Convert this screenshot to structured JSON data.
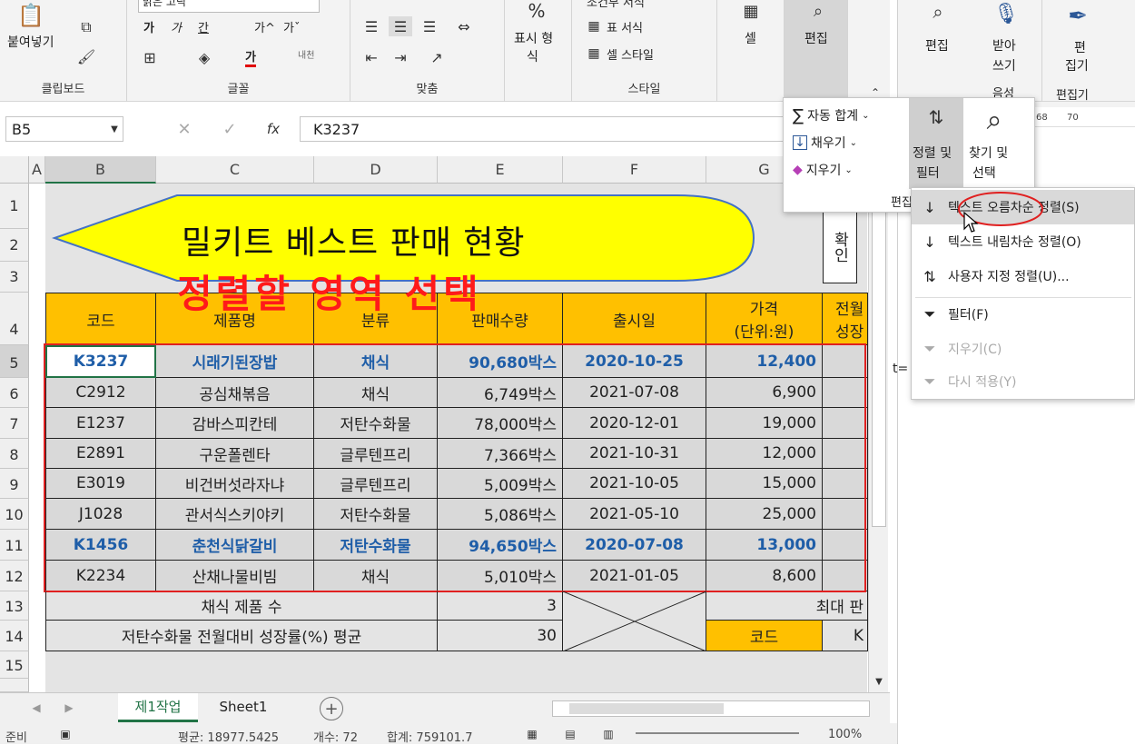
{
  "ribbon": {
    "clipboard": {
      "paste_label": "붙여넣기",
      "group_label": "클립보드"
    },
    "font": {
      "font_name": "맑은 고딕",
      "group_label": "글꼴",
      "bold": "가",
      "italic": "가",
      "underline": "간",
      "grow": "가^",
      "shrink": "가ˇ",
      "font_color": "가",
      "phonetic": "내천"
    },
    "align": {
      "group_label": "맞춤"
    },
    "number": {
      "percent": "%",
      "label1": "표시 형",
      "label2": "식"
    },
    "styles": {
      "cond_format": "조건부 서식",
      "table_format": "표 서식",
      "cell_style": "셀 스타일",
      "group_label": "스타일"
    },
    "cells": {
      "label": "셀"
    },
    "editing": {
      "label": "편집"
    }
  },
  "right_ribbon": {
    "edit_label": "편집",
    "dictation_label1": "받아",
    "dictation_label2": "쓰기",
    "voice_group": "음성",
    "editor_label1": "편",
    "editor_label2": "집기",
    "editor_group": "편집기",
    "zoom_ticks": [
      "68",
      "70"
    ],
    "equals_fragment": "t="
  },
  "formula_bar": {
    "name_box": "B5",
    "formula": "K3237",
    "fx": "fx"
  },
  "columns": [
    "A",
    "B",
    "C",
    "D",
    "E",
    "F",
    "G"
  ],
  "rows": [
    "1",
    "2",
    "3",
    "4",
    "5",
    "6",
    "7",
    "8",
    "9",
    "10",
    "11",
    "12",
    "13",
    "14",
    "15"
  ],
  "banner": {
    "title": "밀키트 베스트 판매 현황",
    "overlay_text": "정렬할 영역 선택",
    "confirm": "확인"
  },
  "table": {
    "headers": [
      "코드",
      "제품명",
      "분류",
      "판매수량",
      "출시일",
      "가격\n(단위:원)",
      "전월\n성장"
    ],
    "price_header_line1": "가격",
    "price_header_line2": "(단위:원)",
    "growth_header_line1": "전월",
    "growth_header_line2": "성장",
    "rows": [
      {
        "code": "K3237",
        "name": "시래기된장밥",
        "category": "채식",
        "qty": "90,680박스",
        "date": "2020-10-25",
        "price": "12,400"
      },
      {
        "code": "C2912",
        "name": "공심채볶음",
        "category": "채식",
        "qty": "6,749박스",
        "date": "2021-07-08",
        "price": "6,900"
      },
      {
        "code": "E1237",
        "name": "감바스피칸테",
        "category": "저탄수화물",
        "qty": "78,000박스",
        "date": "2020-12-01",
        "price": "19,000"
      },
      {
        "code": "E2891",
        "name": "구운폴렌타",
        "category": "글루텐프리",
        "qty": "7,366박스",
        "date": "2021-10-31",
        "price": "12,000"
      },
      {
        "code": "E3019",
        "name": "비건버섯라자냐",
        "category": "글루텐프리",
        "qty": "5,009박스",
        "date": "2021-10-05",
        "price": "15,000"
      },
      {
        "code": "J1028",
        "name": "관서식스키야키",
        "category": "저탄수화물",
        "qty": "5,086박스",
        "date": "2021-05-10",
        "price": "25,000"
      },
      {
        "code": "K1456",
        "name": "춘천식닭갈비",
        "category": "저탄수화물",
        "qty": "94,650박스",
        "date": "2020-07-08",
        "price": "13,000"
      },
      {
        "code": "K2234",
        "name": "산채나물비빔",
        "category": "채식",
        "qty": "5,010박스",
        "date": "2021-01-05",
        "price": "8,600"
      }
    ],
    "summary1_label": "채식 제품 수",
    "summary1_value": "3",
    "summary2_label": "저탄수화물 전월대비 성장률(%) 평균",
    "summary2_value": "30",
    "max_label": "최대 판",
    "code_label": "코드",
    "k_fragment": "K"
  },
  "popup": {
    "autosum": "자동 합계",
    "fill": "채우기",
    "clear": "지우기",
    "sort_filter1": "정렬 및",
    "sort_filter2": "필터",
    "find_select1": "찾기 및",
    "find_select2": "선택",
    "group_label": "편집"
  },
  "menu": {
    "items": [
      {
        "label": "텍스트 오름차순 정렬(S)",
        "enabled": true,
        "icon": "sort-asc-icon"
      },
      {
        "label": "텍스트 내림차순 정렬(O)",
        "enabled": true,
        "icon": "sort-desc-icon"
      },
      {
        "label": "사용자 지정 정렬(U)...",
        "enabled": true,
        "icon": "custom-sort-icon"
      },
      {
        "label": "필터(F)",
        "enabled": true,
        "icon": "filter-icon"
      },
      {
        "label": "지우기(C)",
        "enabled": false,
        "icon": "clear-filter-icon"
      },
      {
        "label": "다시 적용(Y)",
        "enabled": false,
        "icon": "reapply-icon"
      }
    ]
  },
  "sheets": {
    "active": "제1작업",
    "other": "Sheet1",
    "add": "+"
  },
  "status": {
    "ready": "준비",
    "average": "평균: 18977.5425",
    "count": "개수: 72",
    "sum": "합계: 759101.7",
    "zoom": "100%"
  },
  "colors": {
    "header_orange": "#ffc000",
    "selection_red": "#e02020",
    "highlight_blue": "#1f5ea8",
    "banner_yellow": "#ffff00"
  }
}
